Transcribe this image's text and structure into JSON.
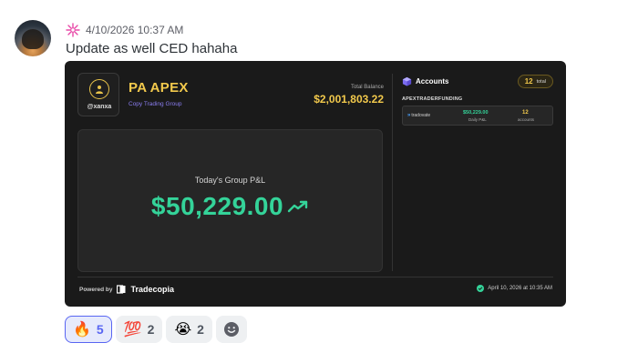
{
  "message": {
    "timestamp": "4/10/2026 10:37 AM",
    "content": "Update as well CED hahaha",
    "role_icon": "sparkle-icon"
  },
  "card": {
    "profile_handle": "@xanxa",
    "group_name": "PA APEX",
    "group_subtitle": "Copy Trading Group",
    "balance_label": "Total Balance",
    "balance_value": "$2,001,803.22",
    "pnl_label": "Today's Group P&L",
    "pnl_value": "$50,229.00",
    "accounts_title": "Accounts",
    "accounts_count": "12",
    "accounts_count_label": "total",
    "prop_firm": "APEXTRADERFUNDING",
    "account_row": {
      "broker": "tradovate",
      "daily_value": "$50,229.00",
      "daily_label": "Daily P&L",
      "count_value": "12",
      "count_label": "accounts"
    },
    "powered_by": "Powered by",
    "brand": "Tradecopia",
    "footer_date": "April 10, 2026 at 10:35 AM",
    "colors": {
      "gold": "#f2c94c",
      "green": "#34d399",
      "purple": "#8a7df0",
      "card_bg": "#1a1a1a"
    }
  },
  "reactions": [
    {
      "emoji": "🔥",
      "icon": "fire-icon",
      "count": "5",
      "active": true
    },
    {
      "emoji": "💯",
      "icon": "hundred-points-icon",
      "count": "2",
      "active": false
    },
    {
      "emoji": "😭",
      "icon": "crying-face-icon",
      "count": "2",
      "active": false
    }
  ],
  "add_reaction_icon": "add-reaction-icon"
}
